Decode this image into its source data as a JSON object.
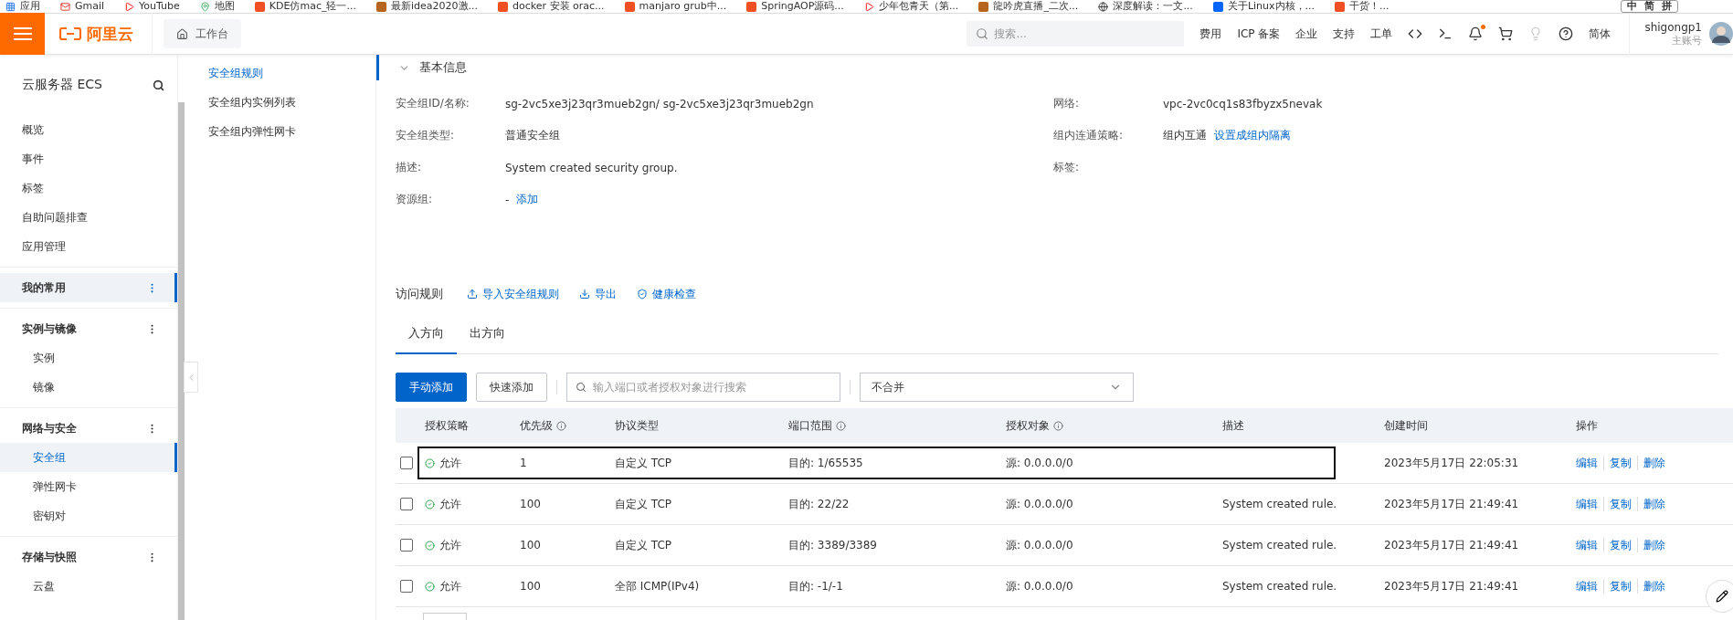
{
  "bookmarks": [
    {
      "label": "应用",
      "kind": "apps"
    },
    {
      "label": "Gmail",
      "kind": "mail"
    },
    {
      "label": "YouTube",
      "kind": "video"
    },
    {
      "label": "地图",
      "kind": "map"
    },
    {
      "label": "KDE仿mac_轻一...",
      "kind": "site"
    },
    {
      "label": "最新idea2020激...",
      "kind": "js"
    },
    {
      "label": "docker 安装 orac...",
      "kind": "site"
    },
    {
      "label": "manjaro grub中...",
      "kind": "site"
    },
    {
      "label": "SpringAOP源码...",
      "kind": "site"
    },
    {
      "label": "少年包青天（第...",
      "kind": "video"
    },
    {
      "label": "龍吟虎直播_二次...",
      "kind": "js"
    },
    {
      "label": "深度解读：一文...",
      "kind": "globe"
    },
    {
      "label": "关于Linux内核，...",
      "kind": "zhi"
    },
    {
      "label": "干货！...",
      "kind": "site"
    }
  ],
  "ime": {
    "items": [
      "中",
      "简",
      "拼"
    ]
  },
  "header": {
    "logo": "阿里云",
    "workbench": "工作台",
    "search_placeholder": "搜索...",
    "links": [
      "费用",
      "ICP 备案",
      "企业",
      "支持",
      "工单"
    ],
    "notification": true,
    "language": "简体",
    "user": {
      "name": "shigongp1",
      "role": "主账号"
    }
  },
  "sidebar": {
    "title": "云服务器 ECS",
    "items": [
      {
        "label": "概览",
        "selected": false
      },
      {
        "label": "事件",
        "selected": false
      },
      {
        "label": "标签",
        "selected": false
      },
      {
        "label": "自助问题排查",
        "selected": false
      },
      {
        "label": "应用管理",
        "selected": false
      }
    ],
    "groups": [
      {
        "label": "我的常用",
        "selected": true
      },
      {
        "label": "实例与镜像",
        "selected": false,
        "items": [
          {
            "label": "实例",
            "selected": false
          },
          {
            "label": "镜像",
            "selected": false
          }
        ]
      },
      {
        "label": "网络与安全",
        "selected": false,
        "items": [
          {
            "label": "安全组",
            "selected": true
          },
          {
            "label": "弹性网卡",
            "selected": false
          },
          {
            "label": "密钥对",
            "selected": false
          }
        ]
      },
      {
        "label": "存储与快照",
        "selected": false,
        "items": [
          {
            "label": "云盘",
            "selected": false
          }
        ]
      }
    ]
  },
  "subnav": [
    {
      "label": "安全组规则",
      "selected": true
    },
    {
      "label": "安全组内实例列表",
      "selected": false
    },
    {
      "label": "安全组内弹性网卡",
      "selected": false
    }
  ],
  "basic_info": {
    "title": "基本信息",
    "left": [
      {
        "label": "安全组ID/名称:",
        "value": "sg-2vc5xe3j23qr3mueb2gn/ sg-2vc5xe3j23qr3mueb2gn"
      },
      {
        "label": "安全组类型:",
        "value": "普通安全组"
      },
      {
        "label": "描述:",
        "value": "System created security group."
      },
      {
        "label": "资源组:",
        "value": "-",
        "link": "添加"
      }
    ],
    "right": [
      {
        "label": "网络:",
        "value": "vpc-2vc0cq1s83fbyzx5nevak"
      },
      {
        "label": "组内连通策略:",
        "value": "组内互通",
        "link": "设置成组内隔离"
      },
      {
        "label": "标签:"
      }
    ]
  },
  "rules": {
    "title": "访问规则",
    "actions": [
      {
        "label": "导入安全组规则",
        "kind": "upload"
      },
      {
        "label": "导出",
        "kind": "download"
      },
      {
        "label": "健康检查",
        "kind": "shield"
      }
    ],
    "tabs": [
      {
        "label": "入方向",
        "selected": true
      },
      {
        "label": "出方向",
        "selected": false
      }
    ],
    "buttons": [
      {
        "label": "手动添加",
        "kind": "primary"
      },
      {
        "label": "快速添加",
        "kind": "normal"
      }
    ],
    "search_placeholder": "输入端口或者授权对象进行搜索",
    "merge_select": "不合并",
    "columns": [
      {
        "label": "授权策略",
        "info": false
      },
      {
        "label": "优先级",
        "info": true
      },
      {
        "label": "协议类型",
        "info": false
      },
      {
        "label": "端口范围",
        "info": true
      },
      {
        "label": "授权对象",
        "info": true
      },
      {
        "label": "描述",
        "info": false
      },
      {
        "label": "创建时间",
        "info": false
      },
      {
        "label": "操作",
        "info": false
      }
    ],
    "rows": [
      {
        "checked": false,
        "highlighted": true,
        "policy": "允许",
        "priority": "1",
        "protocol": "自定义 TCP",
        "port": "目的: 1/65535",
        "source": "源: 0.0.0.0/0",
        "created": "2023年5月17日 22:05:31",
        "actions": [
          "编辑",
          "复制",
          "删除"
        ]
      },
      {
        "checked": false,
        "highlighted": false,
        "policy": "允许",
        "priority": "100",
        "protocol": "自定义 TCP",
        "port": "目的: 22/22",
        "source": "源: 0.0.0.0/0",
        "description": "System created rule.",
        "created": "2023年5月17日 21:49:41",
        "actions": [
          "编辑",
          "复制",
          "删除"
        ]
      },
      {
        "checked": false,
        "highlighted": false,
        "policy": "允许",
        "priority": "100",
        "protocol": "自定义 TCP",
        "port": "目的: 3389/3389",
        "source": "源: 0.0.0.0/0",
        "description": "System created rule.",
        "created": "2023年5月17日 21:49:41",
        "actions": [
          "编辑",
          "复制",
          "删除"
        ]
      },
      {
        "checked": false,
        "highlighted": false,
        "policy": "允许",
        "priority": "100",
        "protocol": "全部 ICMP(IPv4)",
        "port": "目的: -1/-1",
        "source": "源: 0.0.0.0/0",
        "description": "System created rule.",
        "created": "2023年5月17日 21:49:41",
        "actions": [
          "编辑",
          "复制",
          "删除"
        ]
      }
    ]
  }
}
